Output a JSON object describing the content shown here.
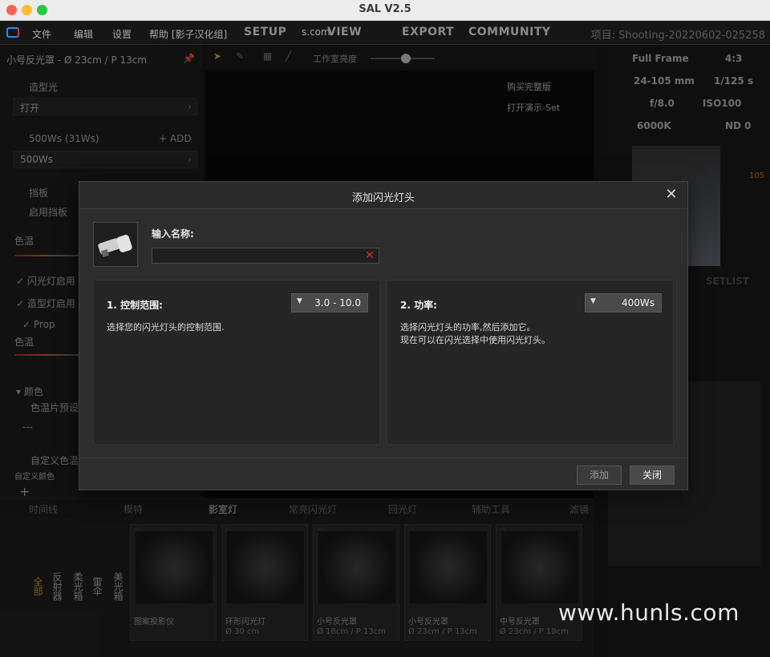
{
  "window": {
    "title": "SAL V2.5"
  },
  "menubar": {
    "items": [
      "文件",
      "编辑",
      "设置",
      "帮助 [影子汉化组]"
    ],
    "tabs": [
      "SETUP",
      "VIEW",
      "EXPORT",
      "COMMUNITY"
    ],
    "url_fragment": "s.com",
    "project": "项目: Shooting-20220602-025258"
  },
  "left_panel": {
    "header": "小号反光罩 - Ø 23cm / P 13cm",
    "model_light": "造型光",
    "model_light_value": "打开",
    "power_label": "500Ws (31Ws)",
    "add_label": "+ ADD",
    "power_value": "500Ws",
    "reflector": "挡板",
    "enable_reflector": "启用挡板",
    "color_temp": "色温",
    "flash_enabled": "闪光灯启用",
    "model_enabled": "造型灯启用",
    "prop": "Prop",
    "color_temp2": "色温",
    "color": "颜色",
    "gel_preset": "色温片预设",
    "dash": "---",
    "custom_temp": "自定义色温",
    "custom_color": "自定义颜色",
    "plus": "+"
  },
  "toolbar2": {
    "studio_brightness": "工作室亮度"
  },
  "viewport": {
    "buy_full": "购买完整版",
    "open_demo": "打开演示-Set"
  },
  "right_panel": {
    "full_frame": "Full Frame",
    "ratio": "4:3",
    "lens": "24-105 mm",
    "shutter": "1/125 s",
    "aperture": "f/8.0",
    "iso": "ISO100",
    "wb": "6000K",
    "nd": "ND 0",
    "setlist": "SETLIST",
    "iso_icon": "105"
  },
  "bottom_tabs": [
    "时间线",
    "模特",
    "影室灯",
    "常亮闪光灯",
    "回光灯",
    "辅助工具",
    "滤镜"
  ],
  "library": {
    "side_tabs": [
      "全部",
      "反射器",
      "柔光箱",
      "雷伞",
      "美光箱"
    ],
    "cards": [
      {
        "name": "图案投影仪",
        "sub": ""
      },
      {
        "name": "环形闪光灯",
        "sub": "Ø 30 cm"
      },
      {
        "name": "小号反光罩",
        "sub": "Ø 18cm / P 13cm"
      },
      {
        "name": "小号反光罩",
        "sub": "Ø 23cm / P 13cm"
      },
      {
        "name": "中号反光罩",
        "sub": "Ø 23cm / P 18cm"
      }
    ]
  },
  "watermark": "www.hunls.com",
  "dialog": {
    "title": "添加闪光灯头",
    "name_label": "输入名称:",
    "name_value": "",
    "section1": {
      "title": "1. 控制范围:",
      "desc": "选择您的闪光灯头的控制范围.",
      "select_value": "3.0 - 10.0"
    },
    "section2": {
      "title": "2. 功率:",
      "desc_line1": "选择闪光灯头的功率,然后添加它。",
      "desc_line2": "现在可以在闪光选择中使用闪光灯头。",
      "select_value": "400Ws"
    },
    "add_button": "添加",
    "close_button": "关闭"
  }
}
